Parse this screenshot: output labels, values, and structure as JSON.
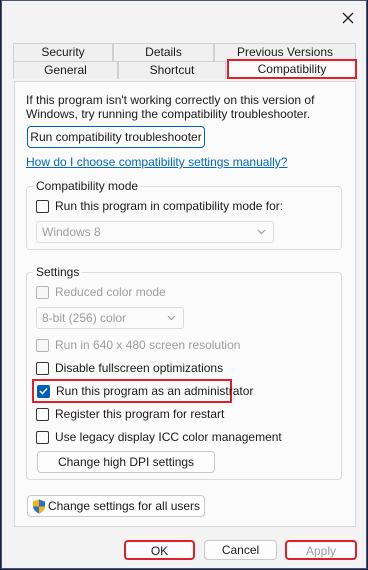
{
  "tabs": {
    "row1": [
      "Security",
      "Details",
      "Previous Versions"
    ],
    "row2": [
      "General",
      "Shortcut",
      "Compatibility"
    ]
  },
  "info_text": "If this program isn't working correctly on this version of Windows, try running the compatibility troubleshooter.",
  "troubleshooter_button": "Run compatibility troubleshooter",
  "help_link": "How do I choose compatibility settings manually?",
  "compat_mode": {
    "legend": "Compatibility mode",
    "checkbox_label": "Run this program in compatibility mode for:",
    "select_value": "Windows 8"
  },
  "settings": {
    "legend": "Settings",
    "reduced_color": "Reduced color mode",
    "color_select": "8-bit (256) color",
    "resolution_640": "Run in 640 x 480 screen resolution",
    "disable_fullscreen": "Disable fullscreen optimizations",
    "run_admin": "Run this program as an administrator",
    "register_restart": "Register this program for restart",
    "legacy_icc": "Use legacy display ICC color management",
    "dpi_button": "Change high DPI settings"
  },
  "all_users_button": "Change settings for all users",
  "footer": {
    "ok": "OK",
    "cancel": "Cancel",
    "apply": "Apply"
  },
  "colors": {
    "accent": "#005fb8",
    "highlight": "#e0202a",
    "link": "#0066cc"
  }
}
